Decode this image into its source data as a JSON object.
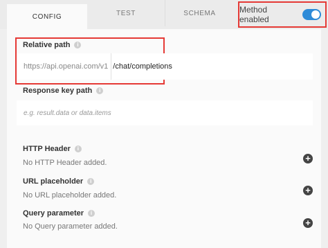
{
  "tabs": [
    {
      "label": "CONFIG"
    },
    {
      "label": "TEST"
    },
    {
      "label": "SCHEMA"
    }
  ],
  "method": {
    "label": "Method enabled",
    "enabled": true
  },
  "relative_path": {
    "label": "Relative path",
    "prefix": "https://api.openai.com/v1",
    "value": "/chat/completions"
  },
  "response_key_path": {
    "label": "Response key path",
    "placeholder": "e.g. result.data or data.items"
  },
  "http_header": {
    "label": "HTTP Header",
    "empty_text": "No HTTP Header added."
  },
  "url_placeholder": {
    "label": "URL placeholder",
    "empty_text": "No URL placeholder added."
  },
  "query_parameter": {
    "label": "Query parameter",
    "empty_text": "No Query parameter added."
  },
  "colors": {
    "accent": "#2e8bd8",
    "highlight": "#e53935"
  }
}
